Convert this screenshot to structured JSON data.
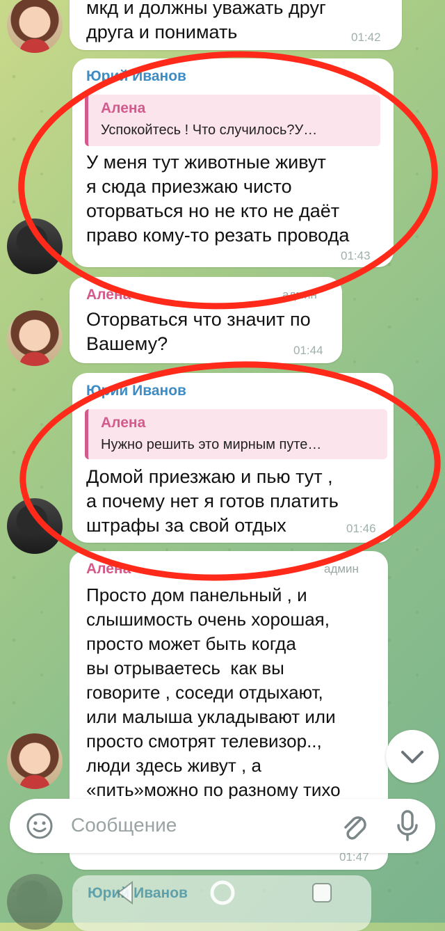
{
  "messages": [
    {
      "sender": "",
      "text": "мкд и должны уважать друг\nдруга и понимать",
      "time": "01:42"
    },
    {
      "sender": "Юрий Иванов",
      "reply": {
        "name": "Алена",
        "text": "Успокойтесь !  Что случилось?У…"
      },
      "text": "У меня тут животные живут\nя сюда приезжаю чисто\nоторваться но не кто не даёт\nправо кому-то резать провода",
      "time": "01:43"
    },
    {
      "sender": "Алена",
      "badge": "админ",
      "text": "Оторваться что значит по\nВашему?",
      "time": "01:44"
    },
    {
      "sender": "Юрий Иванов",
      "reply": {
        "name": "Алена",
        "text": "Нужно решить это мирным путе…"
      },
      "text": "Домой приезжаю и пью тут ,\nа почему нет я готов платить\nштрафы за свой отдых",
      "time": "01:46"
    },
    {
      "sender": "Алена",
      "badge": "админ",
      "text": "Просто дом панельный , и\nслышимость очень хорошая,\nпросто может быть когда\nвы отрываетесь  как вы\nговорите , соседи отдыхают,\nили малыша укладывают или\nпросто смотрят телевизор..,\nлюди здесь живут , а\n«пить»можно по разному тихо",
      "time": "01:47"
    },
    {
      "sender": "Юрий Иванов"
    }
  ],
  "composer": {
    "placeholder": "Сообщение"
  },
  "icons": {
    "emoji": "smile-icon",
    "attach": "paperclip-icon",
    "mic": "microphone-icon",
    "scroll": "chevron-down-icon"
  },
  "colors": {
    "annotation": "#ff2a1a",
    "sender_blue": "#3d8cc4",
    "sender_pink": "#d35a8b"
  }
}
